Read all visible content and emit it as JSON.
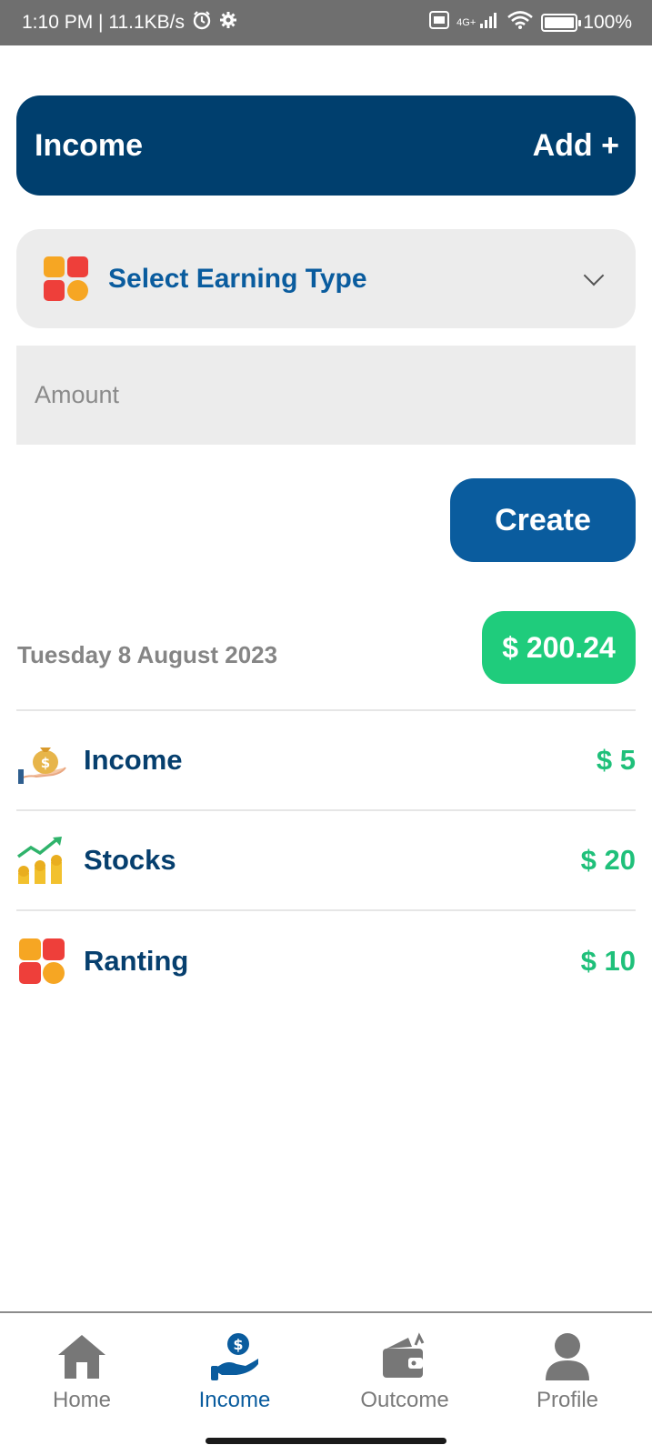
{
  "status_bar": {
    "time_speed": "1:10 PM | 11.1KB/s",
    "network": "4G+",
    "battery": "100%"
  },
  "header": {
    "title": "Income",
    "add_label": "Add +"
  },
  "form": {
    "earning_type_label": "Select Earning Type",
    "amount_placeholder": "Amount",
    "create_label": "Create"
  },
  "summary": {
    "date": "Tuesday 8 August 2023",
    "total": "$ 200.24"
  },
  "entries": [
    {
      "label": "Income",
      "amount": "$ 5",
      "icon": "money-bag-icon"
    },
    {
      "label": "Stocks",
      "amount": "$ 20",
      "icon": "stocks-icon"
    },
    {
      "label": "Ranting",
      "amount": "$ 10",
      "icon": "category-grid-icon"
    }
  ],
  "nav": {
    "items": [
      {
        "label": "Home",
        "icon": "home-icon"
      },
      {
        "label": "Income",
        "icon": "income-hand-icon",
        "active": true
      },
      {
        "label": "Outcome",
        "icon": "wallet-icon"
      },
      {
        "label": "Profile",
        "icon": "profile-icon"
      }
    ]
  },
  "colors": {
    "header_bg": "#003f6e",
    "accent_blue": "#0a5c9e",
    "green": "#1fcc7c",
    "field_bg": "#ececec"
  }
}
